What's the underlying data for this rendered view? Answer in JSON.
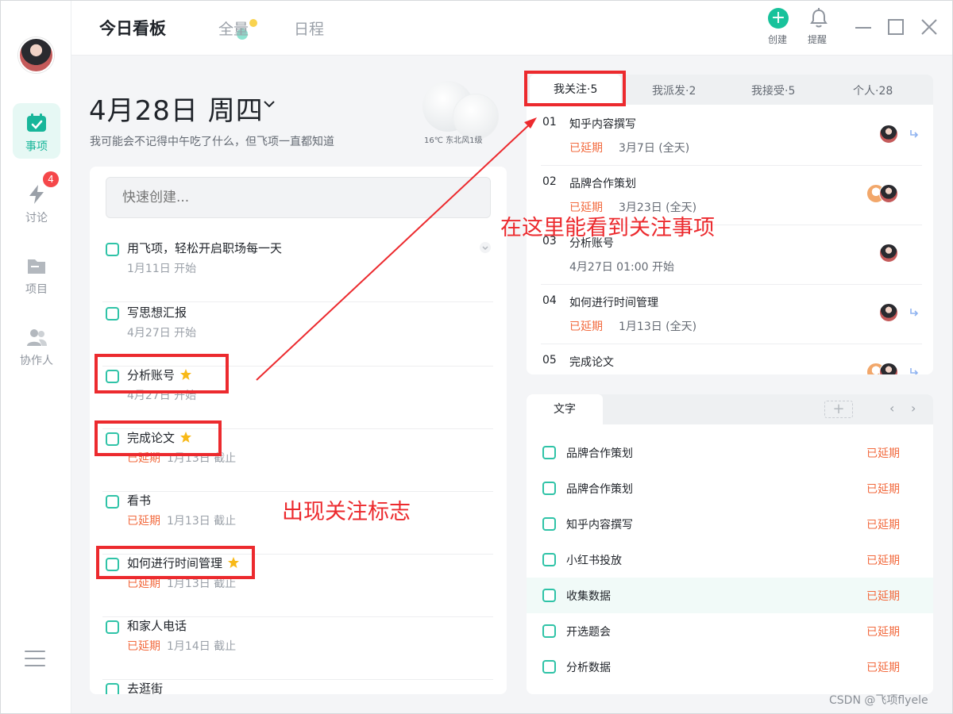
{
  "sidebar": {
    "nav": [
      {
        "label": "事项",
        "icon": "calendar-check-icon",
        "active": true
      },
      {
        "label": "讨论",
        "icon": "lightning-icon",
        "badge": "4"
      },
      {
        "label": "项目",
        "icon": "folder-icon"
      },
      {
        "label": "协作人",
        "icon": "people-icon"
      }
    ]
  },
  "header": {
    "tabs": [
      {
        "label": "今日看板",
        "active": true
      },
      {
        "label": "全量"
      },
      {
        "label": "日程"
      }
    ],
    "create_label": "创建",
    "remind_label": "提醒"
  },
  "today": {
    "date": "4月28日 周四",
    "subtitle": "我可能会不记得中午吃了什么，但飞项一直都知道",
    "weather": "16℃ 东北风1级"
  },
  "tasks": {
    "quick_create_placeholder": "快速创建...",
    "items": [
      {
        "title": "用飞项，轻松开启职场每一天",
        "meta_date": "1月11日 开始",
        "late": "",
        "starred": false
      },
      {
        "title": "写思想汇报",
        "meta_date": "4月27日 开始",
        "late": "",
        "starred": false
      },
      {
        "title": "分析账号",
        "meta_date": "4月27日 开始",
        "late": "",
        "starred": true
      },
      {
        "title": "完成论文",
        "meta_date": "1月13日 截止",
        "late": "已延期",
        "starred": true
      },
      {
        "title": "看书",
        "meta_date": "1月13日 截止",
        "late": "已延期",
        "starred": false
      },
      {
        "title": "如何进行时间管理",
        "meta_date": "1月13日 截止",
        "late": "已延期",
        "starred": true
      },
      {
        "title": "和家人电话",
        "meta_date": "1月14日 截止",
        "late": "已延期",
        "starred": false
      },
      {
        "title": "去逛街",
        "meta_date": "",
        "late": "",
        "starred": false
      }
    ]
  },
  "follow": {
    "tabs": [
      {
        "label": "我关注·5",
        "active": true
      },
      {
        "label": "我派发·2"
      },
      {
        "label": "我接受·5"
      },
      {
        "label": "个人·28"
      }
    ],
    "items": [
      {
        "num": "01",
        "title": "知乎内容撰写",
        "late": "已延期",
        "date": "3月7日 (全天)"
      },
      {
        "num": "02",
        "title": "品牌合作策划",
        "late": "已延期",
        "date": "3月23日 (全天)"
      },
      {
        "num": "03",
        "title": "分析账号",
        "late": "",
        "date": "4月27日 01:00 开始"
      },
      {
        "num": "04",
        "title": "如何进行时间管理",
        "late": "已延期",
        "date": "1月13日 (全天)"
      },
      {
        "num": "05",
        "title": "完成论文",
        "late": "",
        "date": ""
      }
    ]
  },
  "notes": {
    "tab": "文字",
    "add_symbol": "+",
    "prev_symbol": "‹",
    "next_symbol": "›",
    "items": [
      {
        "title": "品牌合作策划",
        "status": "已延期"
      },
      {
        "title": "品牌合作策划",
        "status": "已延期"
      },
      {
        "title": "知乎内容撰写",
        "status": "已延期"
      },
      {
        "title": "小红书投放",
        "status": "已延期"
      },
      {
        "title": "收集数据",
        "status": "已延期"
      },
      {
        "title": "开选题会",
        "status": "已延期"
      },
      {
        "title": "分析数据",
        "status": "已延期"
      }
    ]
  },
  "annotations": {
    "follow_note": "在这里能看到关注事项",
    "star_note": "出现关注标志"
  },
  "watermark": "CSDN @飞项flyele",
  "colors": {
    "accent": "#18c29b",
    "late": "#f26a3e",
    "annotation": "#ec2a2e"
  }
}
